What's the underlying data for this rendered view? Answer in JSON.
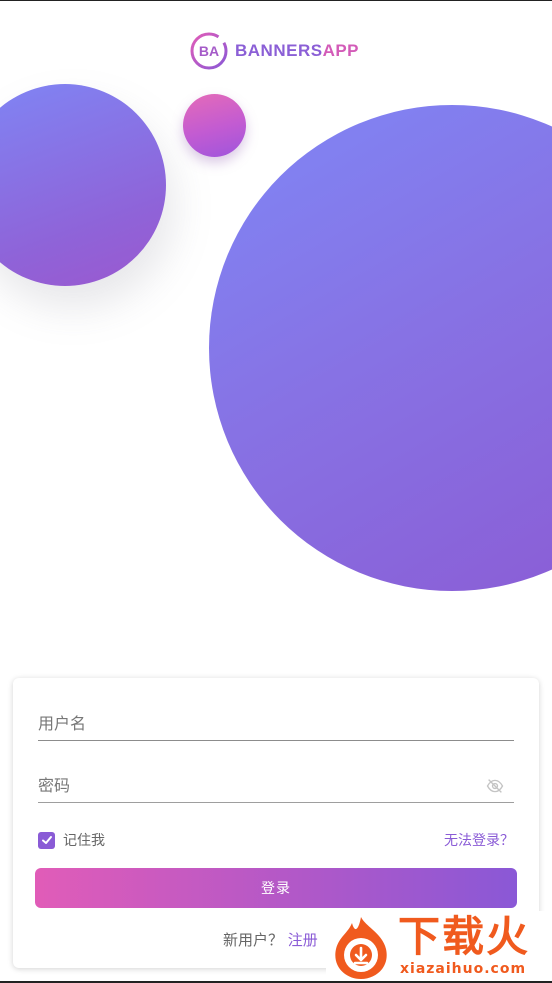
{
  "app": {
    "brand_prefix": "BANNERS",
    "brand_suffix": "APP",
    "logo_monogram": "BA"
  },
  "colors": {
    "primary": "#8a5bd6",
    "pink": "#e15cb8",
    "blue": "#7f87f6",
    "watermark": "#f05a1e"
  },
  "login": {
    "username_placeholder": "用户名",
    "username_value": "",
    "password_placeholder": "密码",
    "password_value": "",
    "remember_label": "记住我",
    "remember_checked": true,
    "forgot_label": "无法登录？",
    "submit_label": "登录",
    "signup_prompt": "新用户？",
    "signup_link": "注册"
  },
  "icons": {
    "password_toggle": "eye-off-icon",
    "remember": "checkmark-icon"
  },
  "watermark": {
    "title": "下载火",
    "url": "xiazaihuo.com"
  }
}
